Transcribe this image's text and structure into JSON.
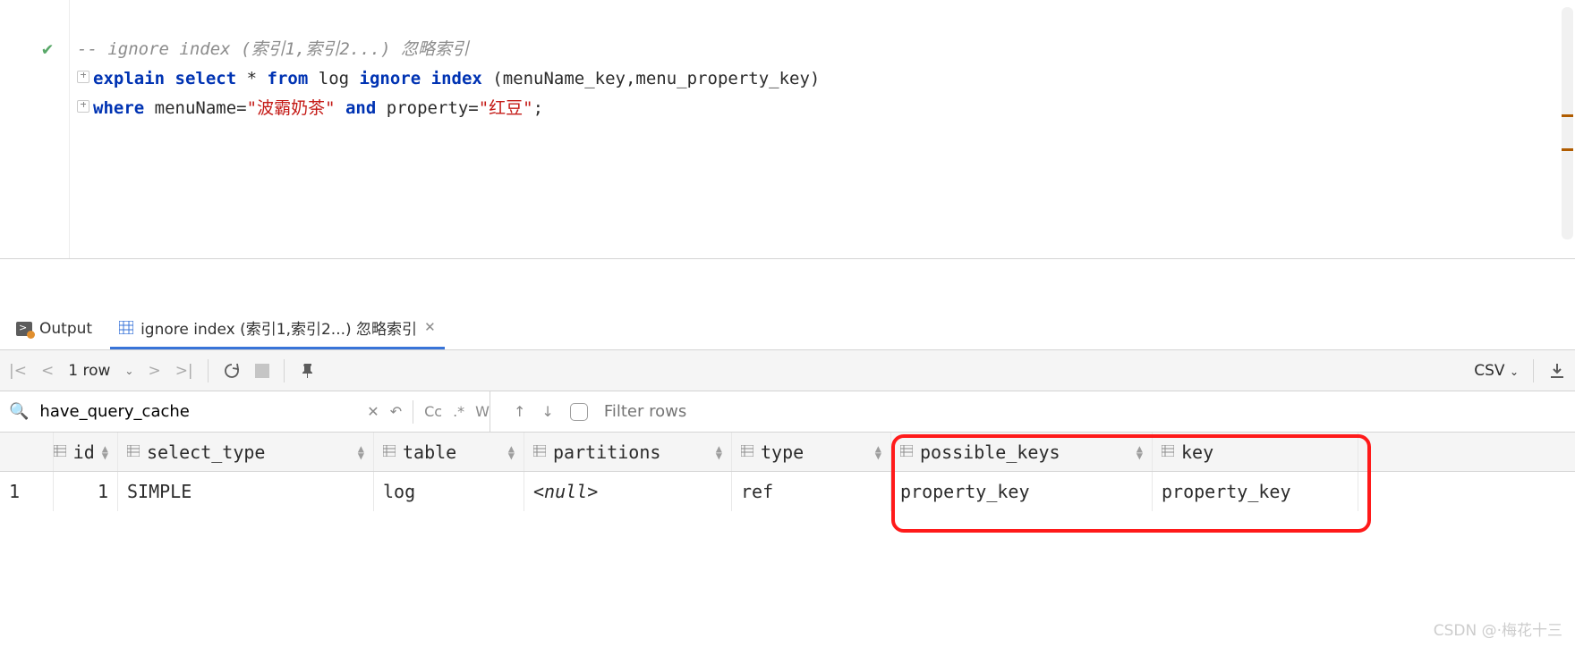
{
  "editor": {
    "comment": "-- ignore index (索引1,索引2...) 忽略索引",
    "line2": {
      "kw1": "explain",
      "kw2": "select",
      "star": "*",
      "kw3": "from",
      "tbl": "log",
      "kw4": "ignore",
      "kw5": "index",
      "args": "(menuName_key,menu_property_key)"
    },
    "line3": {
      "kw1": "where",
      "f1": "menuName",
      "eq": "=",
      "s1": "\"波霸奶茶\"",
      "kw2": "and",
      "f2": "property",
      "eq2": "=",
      "s2": "\"红豆\"",
      "semi": ";"
    }
  },
  "tabs": {
    "output": "Output",
    "active": "ignore index (索引1,索引2...) 忽略索引"
  },
  "toolbar": {
    "rows_label": "1 row",
    "csv": "CSV"
  },
  "filter": {
    "query": "have_query_cache",
    "cc": "Cc",
    "dotstar": ".*",
    "w": "W",
    "placeholder": "Filter rows"
  },
  "columns": [
    "id",
    "select_type",
    "table",
    "partitions",
    "type",
    "possible_keys",
    "key"
  ],
  "row": {
    "num": "1",
    "id": "1",
    "select_type": "SIMPLE",
    "table": "log",
    "partitions": "<null>",
    "type": "ref",
    "possible_keys": "property_key",
    "key": "property_key"
  },
  "watermark": "CSDN @·梅花十三"
}
